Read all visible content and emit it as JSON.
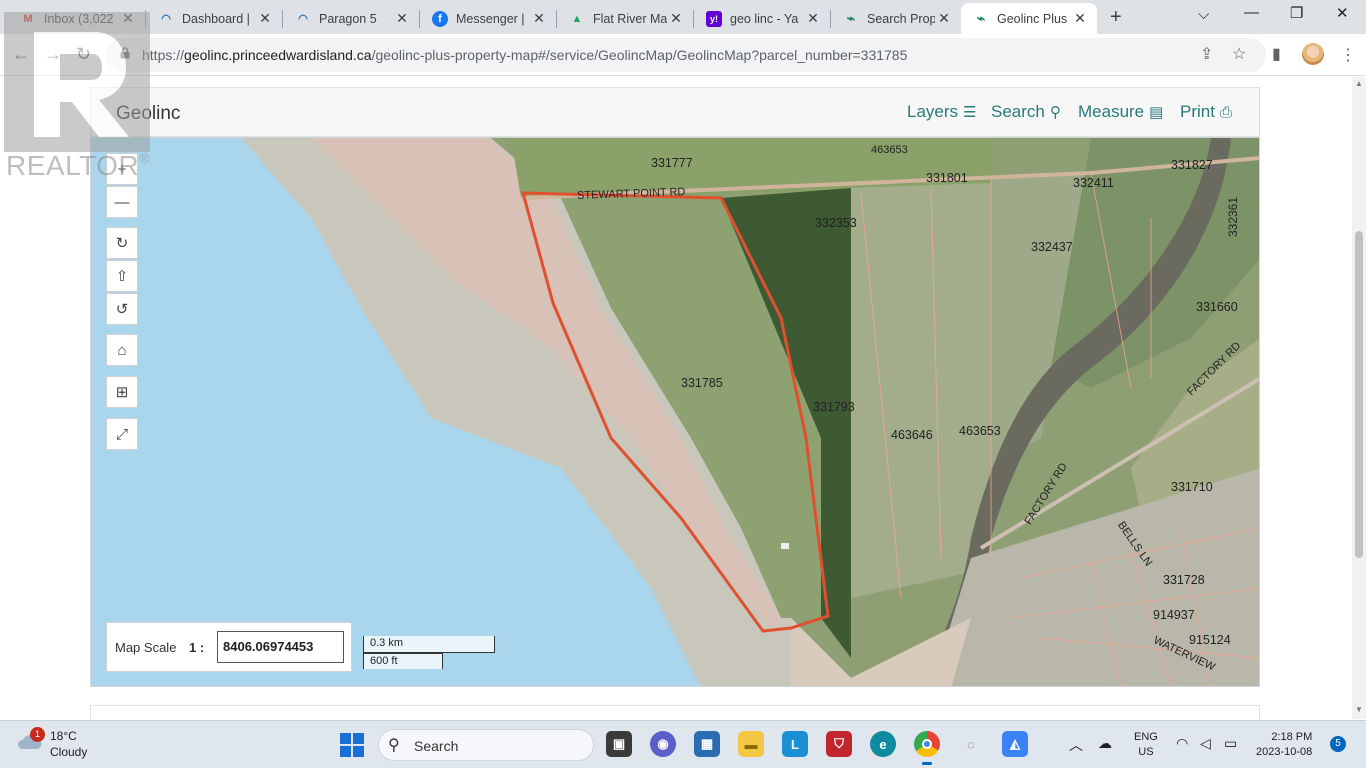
{
  "browser": {
    "tabs": [
      {
        "title": "Inbox (3,022",
        "favicon": "gmail-icon",
        "fav_text": "M",
        "fav_color": "#d93025"
      },
      {
        "title": "Dashboard |",
        "favicon": "arc-icon",
        "fav_text": "◠",
        "fav_color": "#1f6fb5"
      },
      {
        "title": "Paragon 5",
        "favicon": "arc-icon",
        "fav_text": "◠",
        "fav_color": "#1f6fb5"
      },
      {
        "title": "Messenger |",
        "favicon": "facebook-icon",
        "fav_text": "f",
        "fav_color": "#1877f2"
      },
      {
        "title": "Flat River Ma",
        "favicon": "google-drive-icon",
        "fav_text": "▲",
        "fav_color": "#1fa463"
      },
      {
        "title": "geo linc - Ya",
        "favicon": "yahoo-icon",
        "fav_text": "y!",
        "fav_color": "#6001d2"
      },
      {
        "title": "Search Prope",
        "favicon": "geolinc-icon",
        "fav_text": "⌁",
        "fav_color": "#1a7f6b"
      },
      {
        "title": "Geolinc Plus",
        "favicon": "geolinc-icon",
        "fav_text": "⌁",
        "fav_color": "#1a7f6b"
      }
    ],
    "url_domain": "geolinc.princeedwardisland.ca",
    "url_path": "/geolinc-plus-property-map#/service/GeolincMap/GeolincMap?parcel_number=331785",
    "url_scheme": "https://"
  },
  "app": {
    "brand": "Geolinc",
    "nav": {
      "layers": "Layers",
      "search": "Search",
      "measure": "Measure",
      "print": "Print"
    },
    "accent_color": "#2a7a7a"
  },
  "map": {
    "scale_label": "Map Scale",
    "scale_one": "1 :",
    "scale_value": "8406.06974453",
    "scalebar_km": "0.3 km",
    "scalebar_ft": "600 ft",
    "selected_parcel": "331785",
    "parcel_outline_color": "#e0502f",
    "parcels": [
      "331777",
      "463653",
      "331801",
      "332411",
      "331827",
      "332361",
      "332353",
      "332437",
      "331660",
      "331785",
      "331793",
      "463646",
      "463653",
      "331710",
      "331728",
      "914937",
      "915124"
    ],
    "roads": [
      "STEWART POINT RD",
      "FACTORY RD",
      "BELLS LN",
      "WATERVIEW"
    ]
  },
  "watermark": {
    "text": "REALTOR",
    "mark": "®"
  },
  "taskbar": {
    "weather": {
      "temp": "18°C",
      "condition": "Cloudy",
      "badge": "1"
    },
    "search_label": "Search",
    "lang_1": "ENG",
    "lang_2": "US",
    "time": "2:18 PM",
    "date": "2023-10-08",
    "notifications": "5"
  }
}
